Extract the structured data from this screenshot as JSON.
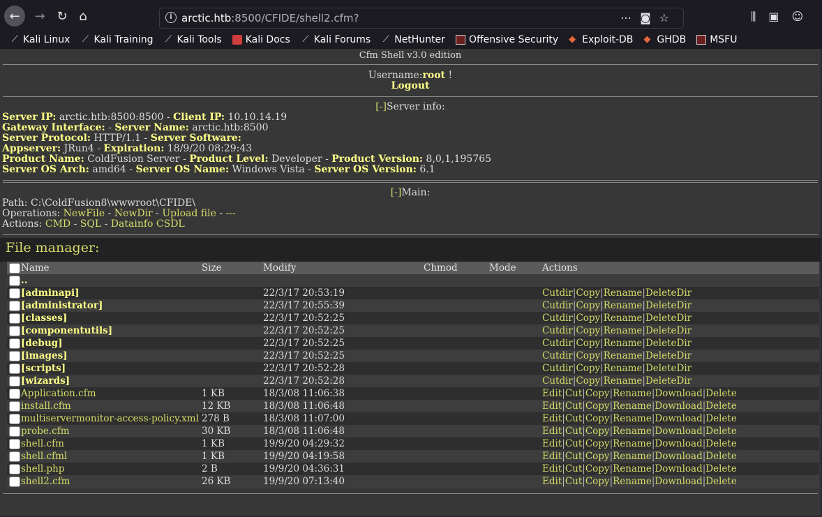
{
  "browser": {
    "url_host": "arctic.htb",
    "url_rest": ":8500/CFIDE/shell2.cfm?",
    "bookmarks": [
      "Kali Linux",
      "Kali Training",
      "Kali Tools",
      "Kali Docs",
      "Kali Forums",
      "NetHunter",
      "Offensive Security",
      "Exploit-DB",
      "GHDB",
      "MSFU"
    ]
  },
  "shell": {
    "edition": "Cfm Shell v3.0 edition",
    "username_label": "Username:",
    "username": "root",
    "username_suffix": " !",
    "logout": "Logout",
    "server_info_toggle": "[-]",
    "server_info_title": "Server info:",
    "server": {
      "ip_label": "Server IP:",
      "ip": " arctic.htb:8500:8500",
      "client_label": "Client IP:",
      "client": " 10.10.14.19",
      "gateway_label": "Gateway Interface:",
      "gateway": "",
      "name_label": "Server Name:",
      "name": " arctic.htb:8500",
      "protocol_label": "Server Protocol:",
      "protocol": " HTTP/1.1",
      "software_label": "Server Software:",
      "software": "",
      "appserver_label": "Appserver:",
      "appserver": " JRun4",
      "expiration_label": "Expiration:",
      "expiration": " 18/9/20 08:29:43",
      "product_label": "Product Name:",
      "product": " ColdFusion Server",
      "level_label": "Product Level:",
      "level": " Developer",
      "version_label": "Product Version:",
      "version": " 8,0,1,195765",
      "arch_label": "Server OS Arch:",
      "arch": " amd64",
      "osname_label": "Server OS Name:",
      "osname": " Windows Vista",
      "osver_label": "Server OS Version:",
      "osver": " 6.1"
    },
    "main_toggle": "[-]",
    "main_title": "Main:",
    "path_label": "Path: ",
    "path": "C:\\ColdFusion8\\wwwroot\\CFIDE\\",
    "operations_label": "Operations: ",
    "operations": [
      "NewFile",
      "NewDir",
      "Upload file",
      "---"
    ],
    "actions_label": "Actions: ",
    "actions": [
      "CMD",
      "SQL",
      "Datainfo CSDL"
    ]
  },
  "file_manager": {
    "title": "File manager:",
    "columns": [
      "Name",
      "Size",
      "Modify",
      "Chmod",
      "Mode",
      "Actions"
    ],
    "parent": "..",
    "dir_actions": [
      "Cutdir",
      "Copy",
      "Rename",
      "DeleteDir"
    ],
    "file_actions": [
      "Edit",
      "Cut",
      "Copy",
      "Rename",
      "Download",
      "Delete"
    ],
    "dirs": [
      {
        "name": "[adminapi]",
        "modify": "22/3/17 20:53:19"
      },
      {
        "name": "[administrator]",
        "modify": "22/3/17 20:55:39"
      },
      {
        "name": "[classes]",
        "modify": "22/3/17 20:52:25"
      },
      {
        "name": "[componentutils]",
        "modify": "22/3/17 20:52:25"
      },
      {
        "name": "[debug]",
        "modify": "22/3/17 20:52:25"
      },
      {
        "name": "[images]",
        "modify": "22/3/17 20:52:25"
      },
      {
        "name": "[scripts]",
        "modify": "22/3/17 20:52:28"
      },
      {
        "name": "[wizards]",
        "modify": "22/3/17 20:52:28"
      }
    ],
    "files": [
      {
        "name": "Application.cfm",
        "size": "1 KB",
        "modify": "18/3/08 11:06:38"
      },
      {
        "name": "install.cfm",
        "size": "12 KB",
        "modify": "18/3/08 11:06:48"
      },
      {
        "name": "multiservermonitor-access-policy.xml",
        "size": "278 B",
        "modify": "18/3/08 11:07:00"
      },
      {
        "name": "probe.cfm",
        "size": "30 KB",
        "modify": "18/3/08 11:06:48"
      },
      {
        "name": "shell.cfm",
        "size": "1 KB",
        "modify": "19/9/20 04:29:32"
      },
      {
        "name": "shell.cfml",
        "size": "1 KB",
        "modify": "19/9/20 04:19:58"
      },
      {
        "name": "shell.php",
        "size": "2 B",
        "modify": "19/9/20 04:36:31"
      },
      {
        "name": "shell2.cfm",
        "size": "26 KB",
        "modify": "19/9/20 07:13:40"
      }
    ]
  }
}
